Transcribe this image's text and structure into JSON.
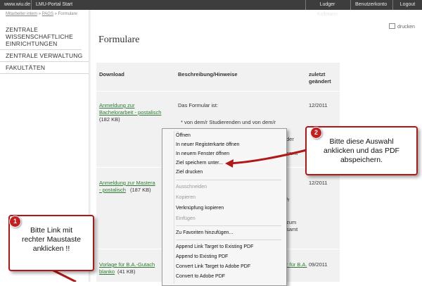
{
  "topbar": {
    "site": "www.wiu.de",
    "portal": "LMU-Portal Start",
    "user": "Ludger Kollmann",
    "account": "Benutzerkonto",
    "logout": "Logout"
  },
  "breadcrumb": {
    "item1": "Mitarbeiter intern",
    "sep1": "»",
    "item2": "PAGS",
    "sep2": "»",
    "item3": "Formulare"
  },
  "sidebar": {
    "items": [
      {
        "label": "ZENTRALE WISSENSCHAFTLICHE EINRICHTUNGEN"
      },
      {
        "label": "ZENTRALE VERWALTUNG"
      },
      {
        "label": "FAKULTÄTEN"
      }
    ]
  },
  "print_label": "drucken",
  "page_title": "Formulare",
  "table": {
    "headers": {
      "download": "Download",
      "description": "Beschreibung/Hinweise",
      "date_line1": "zuletzt",
      "date_line2": "geändert"
    },
    "rows": [
      {
        "link_line1": "Anmeldung zur",
        "link_line2": "Bachelorarbeit - postalisch",
        "size": "(182 KB)",
        "desc_line1": "Das Formular ist:",
        "desc_line2": "* von dem/r Studierenden und von dem/r",
        "desc_frag1": "der",
        "desc_frag2": "samt",
        "date": "12/2011"
      },
      {
        "link_line1": "Anmeldung zur Mastera",
        "link_line2": "- postalisch",
        "size": "(187 KB)",
        "desc_frag1": "/r",
        "desc_frag2": "zum",
        "desc_frag3": "samt",
        "date": "12/2011"
      },
      {
        "link_line1": "Vorlage für B.A.-Gutach",
        "link_line2": "blanko",
        "size": "(41 KB)",
        "desc_link": "vor für B.A.",
        "date": "09/2011"
      }
    ]
  },
  "context_menu": {
    "items": [
      {
        "label": "Öffnen"
      },
      {
        "label": "In neuer Registerkarte öffnen"
      },
      {
        "label": "In neuem Fenster öffnen"
      },
      {
        "label": "Ziel speichern unter..."
      },
      {
        "label": "Ziel drucken"
      },
      {
        "label": "Ausschneiden"
      },
      {
        "label": "Kopieren"
      },
      {
        "label": "Verknüpfung kopieren"
      },
      {
        "label": "Einfügen"
      },
      {
        "label": "Zu Favoriten hinzufügen..."
      },
      {
        "label": "Append Link Target to Existing PDF"
      },
      {
        "label": "Append to Existing PDF"
      },
      {
        "label": "Convert Link Target to Adobe PDF"
      },
      {
        "label": "Convert to Adobe PDF"
      }
    ]
  },
  "callouts": {
    "c2": {
      "number": "2",
      "line1": "Bitte diese Auswahl",
      "line2": "anklicken und das PDF",
      "line3": "abspeichern."
    },
    "c1": {
      "number": "1",
      "line1": "Bitte  Link mit",
      "line2": "rechter Maustaste",
      "line3": "anklicken !!"
    }
  },
  "colors": {
    "accent_red": "#b01818",
    "link_green": "#2f7a33",
    "topbar": "#3d3d3d"
  }
}
